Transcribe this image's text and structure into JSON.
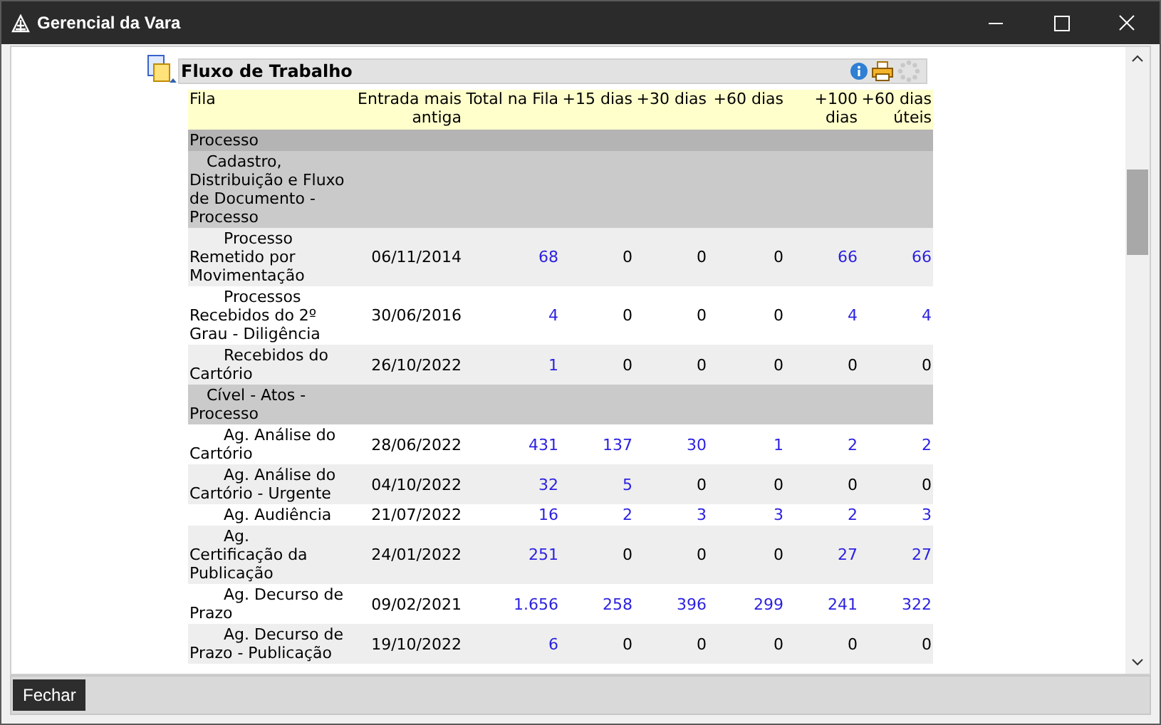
{
  "window": {
    "title": "Gerencial da Vara"
  },
  "panel": {
    "title": "Fluxo de Trabalho"
  },
  "table": {
    "columns": [
      "Fila",
      "Entrada mais antiga",
      "Total na Fila",
      "+15 dias",
      "+30 dias",
      "+60 dias",
      "+100 dias",
      "+60 dias úteis"
    ],
    "groups": [
      {
        "label": "Processo",
        "children": [
          {
            "label": "Cadastro, Distribuição e Fluxo de Documento - Processo",
            "rows": [
              {
                "fila": "Processo Remetido por Movimentação",
                "date": "06/11/2014",
                "cells": [
                  {
                    "v": "68",
                    "link": true
                  },
                  {
                    "v": "0",
                    "link": false
                  },
                  {
                    "v": "0",
                    "link": false
                  },
                  {
                    "v": "0",
                    "link": false
                  },
                  {
                    "v": "66",
                    "link": true
                  },
                  {
                    "v": "66",
                    "link": true
                  }
                ]
              },
              {
                "fila": "Processos Recebidos do 2º Grau - Diligência",
                "date": "30/06/2016",
                "cells": [
                  {
                    "v": "4",
                    "link": true
                  },
                  {
                    "v": "0",
                    "link": false
                  },
                  {
                    "v": "0",
                    "link": false
                  },
                  {
                    "v": "0",
                    "link": false
                  },
                  {
                    "v": "4",
                    "link": true
                  },
                  {
                    "v": "4",
                    "link": true
                  }
                ]
              },
              {
                "fila": "Recebidos do Cartório",
                "date": "26/10/2022",
                "cells": [
                  {
                    "v": "1",
                    "link": true
                  },
                  {
                    "v": "0",
                    "link": false
                  },
                  {
                    "v": "0",
                    "link": false
                  },
                  {
                    "v": "0",
                    "link": false
                  },
                  {
                    "v": "0",
                    "link": false
                  },
                  {
                    "v": "0",
                    "link": false
                  }
                ]
              }
            ]
          },
          {
            "label": "Cível - Atos - Processo",
            "rows": [
              {
                "fila": "Ag. Análise do Cartório",
                "date": "28/06/2022",
                "cells": [
                  {
                    "v": "431",
                    "link": true
                  },
                  {
                    "v": "137",
                    "link": true
                  },
                  {
                    "v": "30",
                    "link": true
                  },
                  {
                    "v": "1",
                    "link": true
                  },
                  {
                    "v": "2",
                    "link": true
                  },
                  {
                    "v": "2",
                    "link": true
                  }
                ]
              },
              {
                "fila": "Ag. Análise do Cartório - Urgente",
                "date": "04/10/2022",
                "cells": [
                  {
                    "v": "32",
                    "link": true
                  },
                  {
                    "v": "5",
                    "link": true
                  },
                  {
                    "v": "0",
                    "link": false
                  },
                  {
                    "v": "0",
                    "link": false
                  },
                  {
                    "v": "0",
                    "link": false
                  },
                  {
                    "v": "0",
                    "link": false
                  }
                ]
              },
              {
                "fila": "Ag. Audiência",
                "date": "21/07/2022",
                "cells": [
                  {
                    "v": "16",
                    "link": true
                  },
                  {
                    "v": "2",
                    "link": true
                  },
                  {
                    "v": "3",
                    "link": true
                  },
                  {
                    "v": "3",
                    "link": true
                  },
                  {
                    "v": "2",
                    "link": true
                  },
                  {
                    "v": "3",
                    "link": true
                  }
                ]
              },
              {
                "fila": "Ag. Certificação da Publicação",
                "date": "24/01/2022",
                "cells": [
                  {
                    "v": "251",
                    "link": true
                  },
                  {
                    "v": "0",
                    "link": false
                  },
                  {
                    "v": "0",
                    "link": false
                  },
                  {
                    "v": "0",
                    "link": false
                  },
                  {
                    "v": "27",
                    "link": true
                  },
                  {
                    "v": "27",
                    "link": true
                  }
                ]
              },
              {
                "fila": "Ag. Decurso de Prazo",
                "date": "09/02/2021",
                "cells": [
                  {
                    "v": "1.656",
                    "link": true
                  },
                  {
                    "v": "258",
                    "link": true
                  },
                  {
                    "v": "396",
                    "link": true
                  },
                  {
                    "v": "299",
                    "link": true
                  },
                  {
                    "v": "241",
                    "link": true
                  },
                  {
                    "v": "322",
                    "link": true
                  }
                ]
              },
              {
                "fila": "Ag. Decurso de Prazo - Publicação",
                "date": "19/10/2022",
                "cells": [
                  {
                    "v": "6",
                    "link": true
                  },
                  {
                    "v": "0",
                    "link": false
                  },
                  {
                    "v": "0",
                    "link": false
                  },
                  {
                    "v": "0",
                    "link": false
                  },
                  {
                    "v": "0",
                    "link": false
                  },
                  {
                    "v": "0",
                    "link": false
                  }
                ]
              }
            ]
          }
        ]
      }
    ]
  },
  "buttons": [
    {
      "label": "Fechar"
    }
  ]
}
